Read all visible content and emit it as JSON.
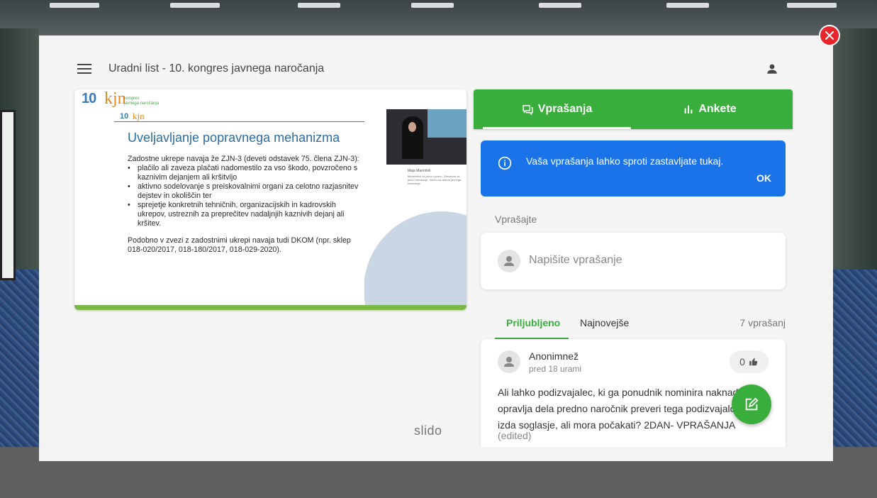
{
  "header": {
    "title": "Uradni list - 10. kongres javnega naročanja"
  },
  "slide": {
    "logo_number": "10",
    "logo_mark": "kjn",
    "logo_text_1": "kongres",
    "logo_text_2": "javnega naročanja",
    "heading": "Uveljavljanje popravnega mehanizma",
    "intro": "Zadostne ukrepe navaja že ZJN-3 (deveti odstavek 75. člena ZJN-3):",
    "bullets": [
      "plačilo ali zaveza plačati nadomestilo za vso škodo, povzročeno s kaznivim dejanjem ali kršitvijo",
      "aktivno sodelovanje s preiskovalnimi organi za celotno razjasnitev dejstev in okoliščin ter",
      "sprejetje konkretnih tehničnih, organizacijskih in kadrovskih ukrepov, ustreznih za preprečitev nadaljnjih kaznivih dejanj ali kršitev."
    ],
    "closing": "Podobno v zvezi z zadostnimi ukrepi navaja tudi DKOM (npr. sklep 018-020/2017, 018-180/2017, 018-029-2020).",
    "speaker_name": "Maja Marinček",
    "speaker_role": "Ministrstvo za javno upravo, Direktorat za javno naročanje, Sektor za sistem javnega naročanja"
  },
  "brand": "slido",
  "tabs": {
    "questions": "Vprašanja",
    "polls": "Ankete"
  },
  "info": {
    "text": "Vaša vprašanja lahko sproti zastavljate tukaj.",
    "ok": "OK"
  },
  "ask": {
    "label": "Vprašajte",
    "placeholder": "Napišite vprašanje"
  },
  "sort": {
    "popular": "Priljubljeno",
    "newest": "Najnovejše",
    "count": "7 vprašanj"
  },
  "question": {
    "author": "Anonimnež",
    "time": "pred 18 urami",
    "likes": "0",
    "text": "Ali lahko podizvajalec, ki ga ponudnik nominira naknadno,\nopravlja dela predno naročnik preveri tega podizvajalca in\nizda soglasje, ali mora počakati? 2DAN- VPRAŠANJA",
    "edited": "(edited)"
  },
  "colors": {
    "accent_green": "#3aae3c",
    "info_blue": "#1a73e8",
    "close_red": "#e8242c"
  }
}
